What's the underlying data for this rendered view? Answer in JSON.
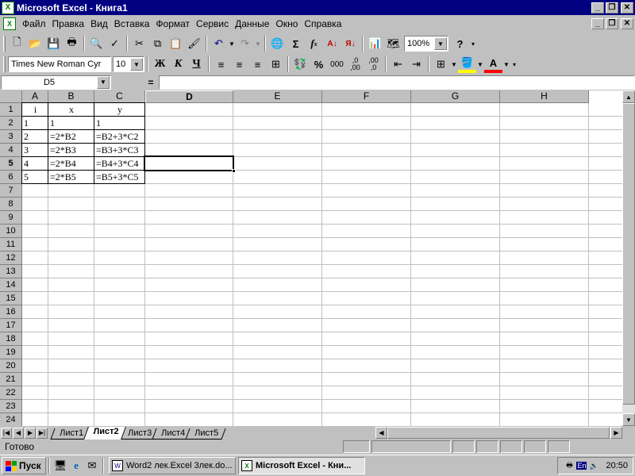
{
  "window": {
    "title": "Microsoft Excel - Книга1",
    "app_icon": "excel-icon"
  },
  "menu": {
    "items": [
      "Файл",
      "Правка",
      "Вид",
      "Вставка",
      "Формат",
      "Сервис",
      "Данные",
      "Окно",
      "Справка"
    ]
  },
  "toolbar_standard": {
    "zoom": "100%",
    "buttons": [
      "new-icon",
      "open-icon",
      "save-icon",
      "print-icon",
      "print-preview-icon",
      "spelling-icon",
      "cut-icon",
      "copy-icon",
      "paste-icon",
      "format-painter-icon",
      "undo-icon",
      "redo-icon",
      "hyperlink-icon",
      "autosum-icon",
      "function-icon",
      "sort-ascending-icon",
      "sort-descending-icon",
      "chart-wizard-icon",
      "map-icon",
      "help-icon"
    ],
    "sum_glyph": "Σ",
    "fx_glyph": "f",
    "fx_sub": "x"
  },
  "toolbar_formatting": {
    "font": "Times New Roman Cyr",
    "size": "10",
    "bold": "Ж",
    "italic": "К",
    "underline": "Ч",
    "percent": "%",
    "thousands": "000",
    "inc_decimal": ",0",
    "inc_decimal_sub": ",00",
    "dec_decimal": ",00",
    "dec_decimal_sub": ",0"
  },
  "formula_bar": {
    "name_box": "D5",
    "equals": "=",
    "formula": ""
  },
  "grid": {
    "columns": [
      "A",
      "B",
      "C",
      "D",
      "E",
      "F",
      "G",
      "H"
    ],
    "active_column": "D",
    "rows": [
      "1",
      "2",
      "3",
      "4",
      "5",
      "6",
      "7",
      "8",
      "9",
      "10",
      "11",
      "12",
      "13",
      "14",
      "15",
      "16",
      "17",
      "18",
      "19",
      "20",
      "21",
      "22",
      "23",
      "24"
    ],
    "active_row": "5",
    "cells": {
      "A1": "i",
      "B1": "x",
      "C1": "y",
      "A2": "1",
      "B2": "1",
      "C2": "1",
      "A3": "2",
      "B3": "=2*B2",
      "C3": "=B2+3*C2",
      "A4": "3",
      "B4": "=2*B3",
      "C4": "=B3+3*C3",
      "A5": "4",
      "B5": "=2*B4",
      "C5": "=B4+3*C4",
      "A6": "5",
      "B6": "=2*B5",
      "C6": "=B5+3*C5"
    }
  },
  "sheet_tabs": {
    "tabs": [
      "Лист1",
      "Лист2",
      "Лист3",
      "Лист4",
      "Лист5"
    ],
    "active": "Лист2"
  },
  "status": {
    "text": "Готово"
  },
  "taskbar": {
    "start": "Пуск",
    "tasks": [
      "Word2 лек.Excel 3лек.do...",
      "Microsoft Excel - Кни..."
    ],
    "active_task": "Microsoft Excel - Кни...",
    "lang": "En",
    "clock": "20:50"
  }
}
